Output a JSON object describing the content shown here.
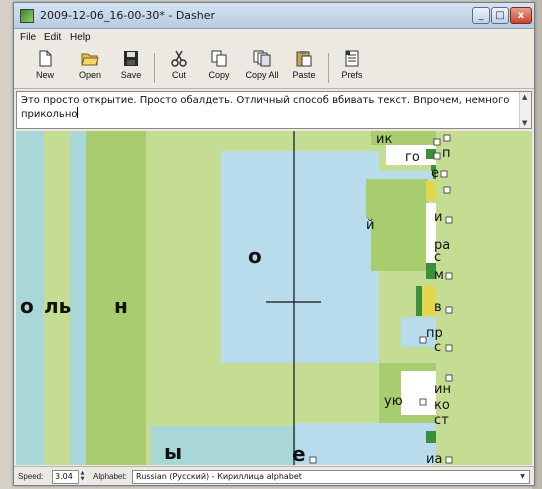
{
  "window": {
    "title": "2009-12-06_16-00-30* - Dasher",
    "controls": {
      "minimize": "_",
      "maximize": "□",
      "close": "x"
    }
  },
  "menu": [
    "File",
    "Edit",
    "Help"
  ],
  "toolbar": {
    "new": "New",
    "open": "Open",
    "save": "Save",
    "cut": "Cut",
    "copy": "Copy",
    "copy_all": "Copy All",
    "paste": "Paste",
    "prefs": "Prefs"
  },
  "editor": {
    "text": "Это просто открытие. Просто обалдеть. Отличный способ вбивать текст. Впрочем, немного прикольно"
  },
  "canvas": {
    "labels": {
      "ik": "ик",
      "go": "го",
      "p": "п",
      "e_small": "е",
      "i": "и",
      "y_short": "й",
      "ra": "ра",
      "s": "с",
      "m": "м",
      "o_big": "о",
      "o_l": "о",
      "l": "ль",
      "n": "н",
      "v": "в",
      "pr": "пр",
      "s2": "с",
      "yu": "ую",
      "in": "ин",
      "ko": "ко",
      "st": "ст",
      "y_hard": "ы",
      "e_big": "е",
      "ia": "иа"
    }
  },
  "statusbar": {
    "speed_label": "Speed:",
    "speed_value": "3.04",
    "alphabet_label": "Alphabet:",
    "alphabet_value": "Russian (Русский) - Кириллица alphabet"
  },
  "colors": {
    "pale_cyan": "#a9d6d6",
    "light_green": "#c4dd93",
    "mid_green": "#a8cd6e",
    "light_blue": "#b9dcec",
    "yellow": "#e2d64a",
    "dark_green": "#3b8f3b"
  }
}
